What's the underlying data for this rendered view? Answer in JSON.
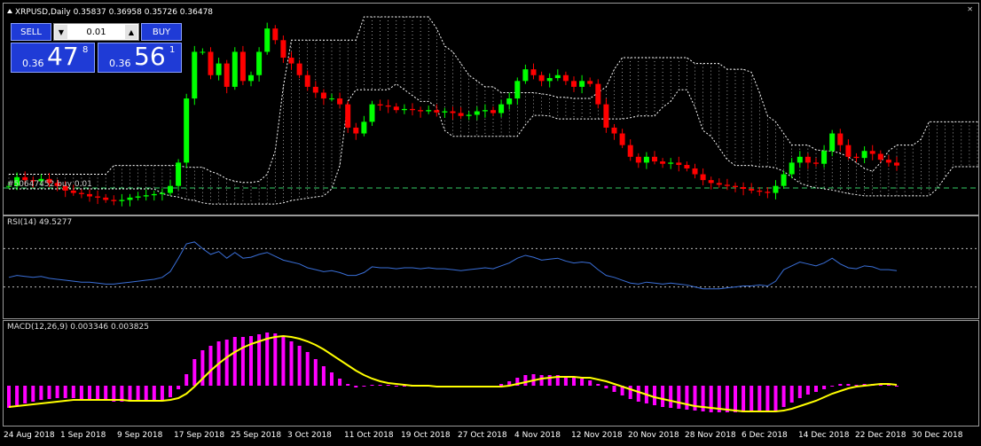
{
  "symbol_header": "XRPUSD,Daily  0.35837 0.36958 0.35726 0.36478",
  "trade_panel": {
    "sell_label": "SELL",
    "buy_label": "BUY",
    "lot_value": "0.01",
    "sell_price": {
      "small": "0.36",
      "big": "47",
      "sup": "8"
    },
    "buy_price": {
      "small": "0.36",
      "big": "56",
      "sup": "1"
    }
  },
  "order_line_label": "#50647452 buy 0.01",
  "rsi_label": "RSI(14) 49.5277",
  "macd_label": "MACD(12,26,9) 0.003346 0.003825",
  "time_axis": [
    "24 Aug 2018",
    "1 Sep 2018",
    "9 Sep 2018",
    "17 Sep 2018",
    "25 Sep 2018",
    "3 Oct 2018",
    "11 Oct 2018",
    "19 Oct 2018",
    "27 Oct 2018",
    "4 Nov 2018",
    "12 Nov 2018",
    "20 Nov 2018",
    "28 Nov 2018",
    "6 Dec 2018",
    "14 Dec 2018",
    "22 Dec 2018",
    "30 Dec 2018"
  ],
  "colors": {
    "bull": "#00ff00",
    "bear": "#ff0000",
    "rsi": "#3a6fd8",
    "macd_hist": "#ff00ff",
    "macd_signal": "#ffff00",
    "cloud": "#ffffff",
    "panel": "#1f3bd6",
    "order_line": "#33cc66"
  },
  "chart_data": {
    "type": "candlestick",
    "closes": [
      0.33,
      0.345,
      0.34,
      0.338,
      0.342,
      0.335,
      0.33,
      0.322,
      0.318,
      0.316,
      0.312,
      0.31,
      0.306,
      0.304,
      0.306,
      0.31,
      0.312,
      0.314,
      0.316,
      0.318,
      0.33,
      0.37,
      0.48,
      0.56,
      0.56,
      0.52,
      0.54,
      0.5,
      0.56,
      0.51,
      0.52,
      0.56,
      0.6,
      0.58,
      0.55,
      0.54,
      0.52,
      0.5,
      0.49,
      0.48,
      0.48,
      0.47,
      0.43,
      0.42,
      0.44,
      0.47,
      0.468,
      0.466,
      0.46,
      0.462,
      0.46,
      0.458,
      0.46,
      0.456,
      0.458,
      0.455,
      0.45,
      0.452,
      0.458,
      0.46,
      0.455,
      0.47,
      0.48,
      0.51,
      0.53,
      0.52,
      0.51,
      0.515,
      0.52,
      0.51,
      0.5,
      0.51,
      0.505,
      0.47,
      0.43,
      0.42,
      0.4,
      0.38,
      0.37,
      0.38,
      0.372,
      0.368,
      0.37,
      0.366,
      0.36,
      0.35,
      0.34,
      0.335,
      0.332,
      0.33,
      0.328,
      0.325,
      0.322,
      0.32,
      0.318,
      0.33,
      0.35,
      0.37,
      0.38,
      0.37,
      0.368,
      0.39,
      0.42,
      0.4,
      0.38,
      0.378,
      0.39,
      0.385,
      0.375,
      0.37,
      0.365
    ],
    "rsi": [
      40,
      42,
      41,
      40,
      41,
      39,
      38,
      37,
      36,
      35,
      35,
      34,
      33,
      33,
      34,
      35,
      36,
      37,
      38,
      40,
      46,
      60,
      75,
      77,
      70,
      64,
      67,
      60,
      66,
      60,
      61,
      64,
      66,
      62,
      58,
      56,
      54,
      50,
      48,
      46,
      47,
      45,
      42,
      42,
      45,
      51,
      50,
      50,
      49,
      50,
      50,
      49,
      50,
      49,
      49,
      48,
      47,
      48,
      49,
      50,
      49,
      52,
      55,
      60,
      63,
      61,
      58,
      59,
      60,
      57,
      55,
      56,
      55,
      48,
      42,
      40,
      37,
      34,
      33,
      35,
      34,
      33,
      34,
      33,
      32,
      30,
      28,
      28,
      28,
      29,
      30,
      31,
      31,
      32,
      31,
      36,
      48,
      52,
      56,
      54,
      52,
      55,
      60,
      54,
      50,
      49,
      52,
      51,
      48,
      48,
      47
    ],
    "macd": [
      -0.025,
      -0.022,
      -0.02,
      -0.018,
      -0.016,
      -0.015,
      -0.014,
      -0.014,
      -0.014,
      -0.015,
      -0.015,
      -0.016,
      -0.017,
      -0.018,
      -0.018,
      -0.018,
      -0.018,
      -0.018,
      -0.017,
      -0.016,
      -0.013,
      -0.004,
      0.013,
      0.03,
      0.04,
      0.045,
      0.05,
      0.052,
      0.055,
      0.055,
      0.056,
      0.058,
      0.06,
      0.059,
      0.055,
      0.05,
      0.045,
      0.038,
      0.03,
      0.022,
      0.015,
      0.008,
      0.002,
      -0.002,
      -0.001,
      0.001,
      0.001,
      0.001,
      0.0,
      0.0,
      0.0,
      -0.001,
      -0.001,
      -0.001,
      -0.001,
      -0.002,
      -0.002,
      -0.002,
      -0.001,
      -0.001,
      -0.001,
      0.002,
      0.005,
      0.009,
      0.012,
      0.013,
      0.012,
      0.012,
      0.012,
      0.011,
      0.009,
      0.008,
      0.006,
      0.002,
      -0.003,
      -0.007,
      -0.011,
      -0.015,
      -0.018,
      -0.02,
      -0.022,
      -0.024,
      -0.025,
      -0.026,
      -0.027,
      -0.028,
      -0.029,
      -0.03,
      -0.03,
      -0.03,
      -0.03,
      -0.03,
      -0.03,
      -0.03,
      -0.03,
      -0.028,
      -0.024,
      -0.019,
      -0.014,
      -0.01,
      -0.007,
      -0.004,
      0.0,
      0.002,
      0.002,
      0.001,
      0.002,
      0.002,
      0.001,
      0.001,
      0.0
    ],
    "signal": [
      -0.024,
      -0.023,
      -0.022,
      -0.021,
      -0.02,
      -0.019,
      -0.018,
      -0.017,
      -0.016,
      -0.016,
      -0.016,
      -0.016,
      -0.016,
      -0.016,
      -0.016,
      -0.017,
      -0.017,
      -0.017,
      -0.017,
      -0.017,
      -0.016,
      -0.014,
      -0.009,
      -0.001,
      0.008,
      0.017,
      0.025,
      0.032,
      0.038,
      0.043,
      0.047,
      0.05,
      0.053,
      0.055,
      0.056,
      0.055,
      0.053,
      0.05,
      0.046,
      0.041,
      0.035,
      0.029,
      0.023,
      0.017,
      0.012,
      0.008,
      0.005,
      0.003,
      0.002,
      0.001,
      0.0,
      0.0,
      0.0,
      -0.001,
      -0.001,
      -0.001,
      -0.001,
      -0.001,
      -0.001,
      -0.001,
      -0.001,
      -0.001,
      0.0,
      0.002,
      0.004,
      0.006,
      0.008,
      0.009,
      0.01,
      0.01,
      0.01,
      0.009,
      0.009,
      0.007,
      0.005,
      0.002,
      -0.001,
      -0.004,
      -0.007,
      -0.01,
      -0.013,
      -0.015,
      -0.017,
      -0.019,
      -0.021,
      -0.023,
      -0.024,
      -0.025,
      -0.026,
      -0.027,
      -0.028,
      -0.029,
      -0.029,
      -0.029,
      -0.029,
      -0.029,
      -0.028,
      -0.026,
      -0.023,
      -0.02,
      -0.017,
      -0.013,
      -0.009,
      -0.006,
      -0.003,
      -0.001,
      0.0,
      0.001,
      0.002,
      0.002,
      0.001
    ]
  }
}
